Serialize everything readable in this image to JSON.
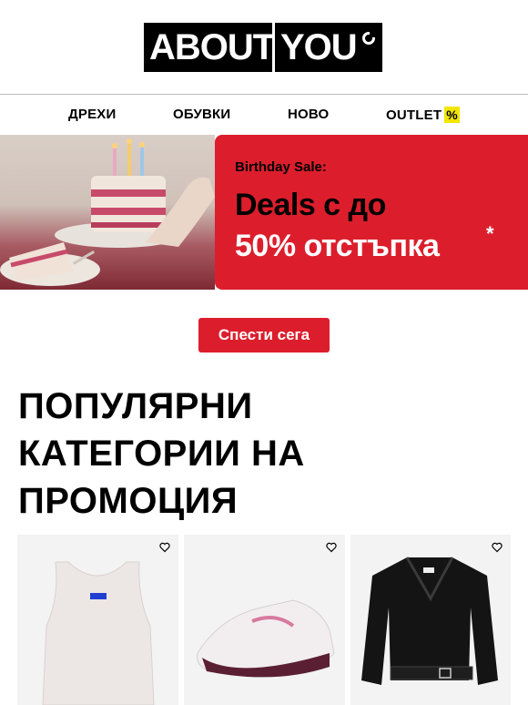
{
  "header": {
    "logo_left": "ABOUT",
    "logo_right": "YOU"
  },
  "nav": {
    "items": [
      {
        "label": "ДРЕХИ"
      },
      {
        "label": "ОБУВКИ"
      },
      {
        "label": "НОВО"
      },
      {
        "label": "OUTLET",
        "badge": "%"
      }
    ]
  },
  "banner": {
    "kicker": "Birthday Sale:",
    "headline_line1": "Deals с до",
    "headline_line2": "50% отстъпка",
    "asterisk": "*",
    "accent_color": "#dc1e2c"
  },
  "cta": {
    "label": "Спести сега"
  },
  "section": {
    "title": "ПОПУЛЯРНИ КАТЕГОРИИ НА ПРОМОЦИЯ"
  },
  "products": [
    {
      "icon": "heart-icon",
      "image": "white tank top"
    },
    {
      "icon": "heart-icon",
      "image": "sneaker"
    },
    {
      "icon": "heart-icon",
      "image": "leather jacket"
    }
  ]
}
